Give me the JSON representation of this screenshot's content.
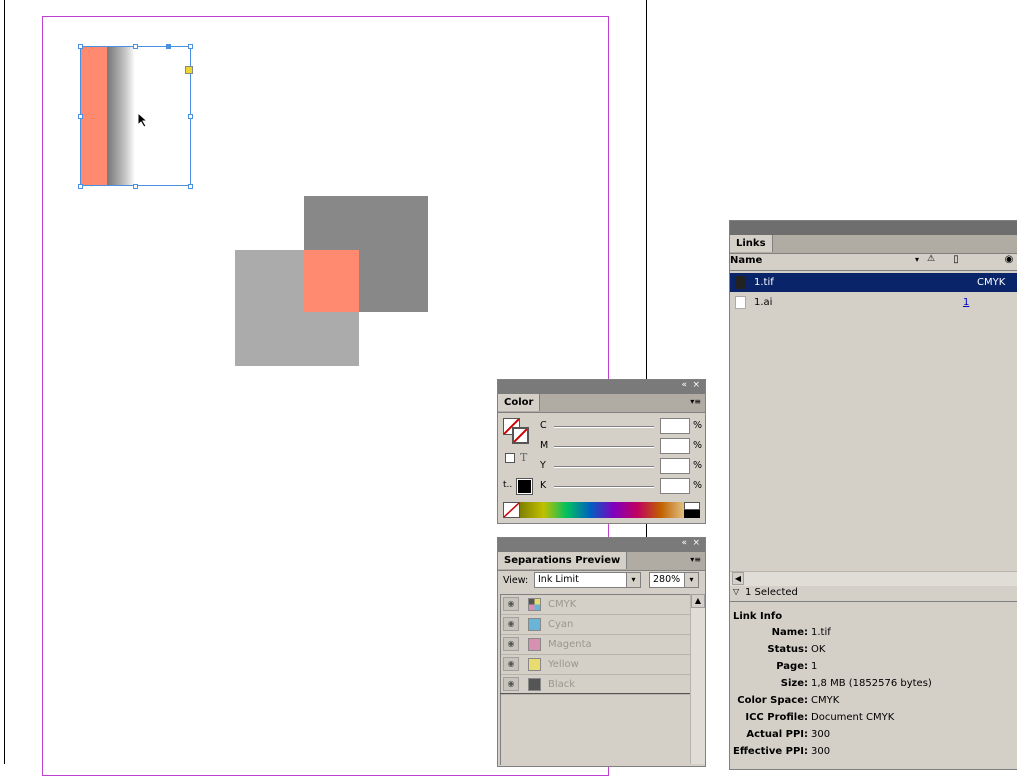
{
  "color_panel": {
    "title": "Color",
    "channels": [
      {
        "label": "C",
        "value": "",
        "unit": "%"
      },
      {
        "label": "M",
        "value": "",
        "unit": "%"
      },
      {
        "label": "Y",
        "value": "",
        "unit": "%"
      },
      {
        "label": "K",
        "value": "",
        "unit": "%"
      }
    ],
    "text_glyph": "T"
  },
  "separations_panel": {
    "title": "Separations Preview",
    "view_label": "View:",
    "view_value": "Ink Limit",
    "ink_limit_value": "280%",
    "inks": [
      {
        "name": "CMYK",
        "swatch": "cmyk"
      },
      {
        "name": "Cyan",
        "swatch": "#6ab4d8"
      },
      {
        "name": "Magenta",
        "swatch": "#d890b0"
      },
      {
        "name": "Yellow",
        "swatch": "#e8dc70"
      },
      {
        "name": "Black",
        "swatch": "#555555"
      }
    ]
  },
  "links_panel": {
    "title": "Links",
    "col_name": "Name",
    "rows": [
      {
        "name": "1.tif",
        "extra": "CMYK"
      },
      {
        "name": "1.ai",
        "extra": "1"
      }
    ],
    "selected_count": "1 Selected",
    "info_title": "Link Info",
    "info": [
      {
        "label": "Name:",
        "value": "1.tif"
      },
      {
        "label": "Status:",
        "value": "OK"
      },
      {
        "label": "Page:",
        "value": "1"
      },
      {
        "label": "Size:",
        "value": "1,8 MB (1852576 bytes)"
      },
      {
        "label": "Color Space:",
        "value": "CMYK"
      },
      {
        "label": "ICC Profile:",
        "value": "Document CMYK"
      },
      {
        "label": "Actual PPI:",
        "value": "300"
      },
      {
        "label": "Effective PPI:",
        "value": "300"
      }
    ]
  },
  "colors": {
    "salmon": "#ff8a70",
    "dark_gray": "#888888",
    "light_gray": "#ababab",
    "selection_blue": "#4a90e2",
    "guide_purple": "#c040d0",
    "links_selected_bg": "#0a246a"
  }
}
